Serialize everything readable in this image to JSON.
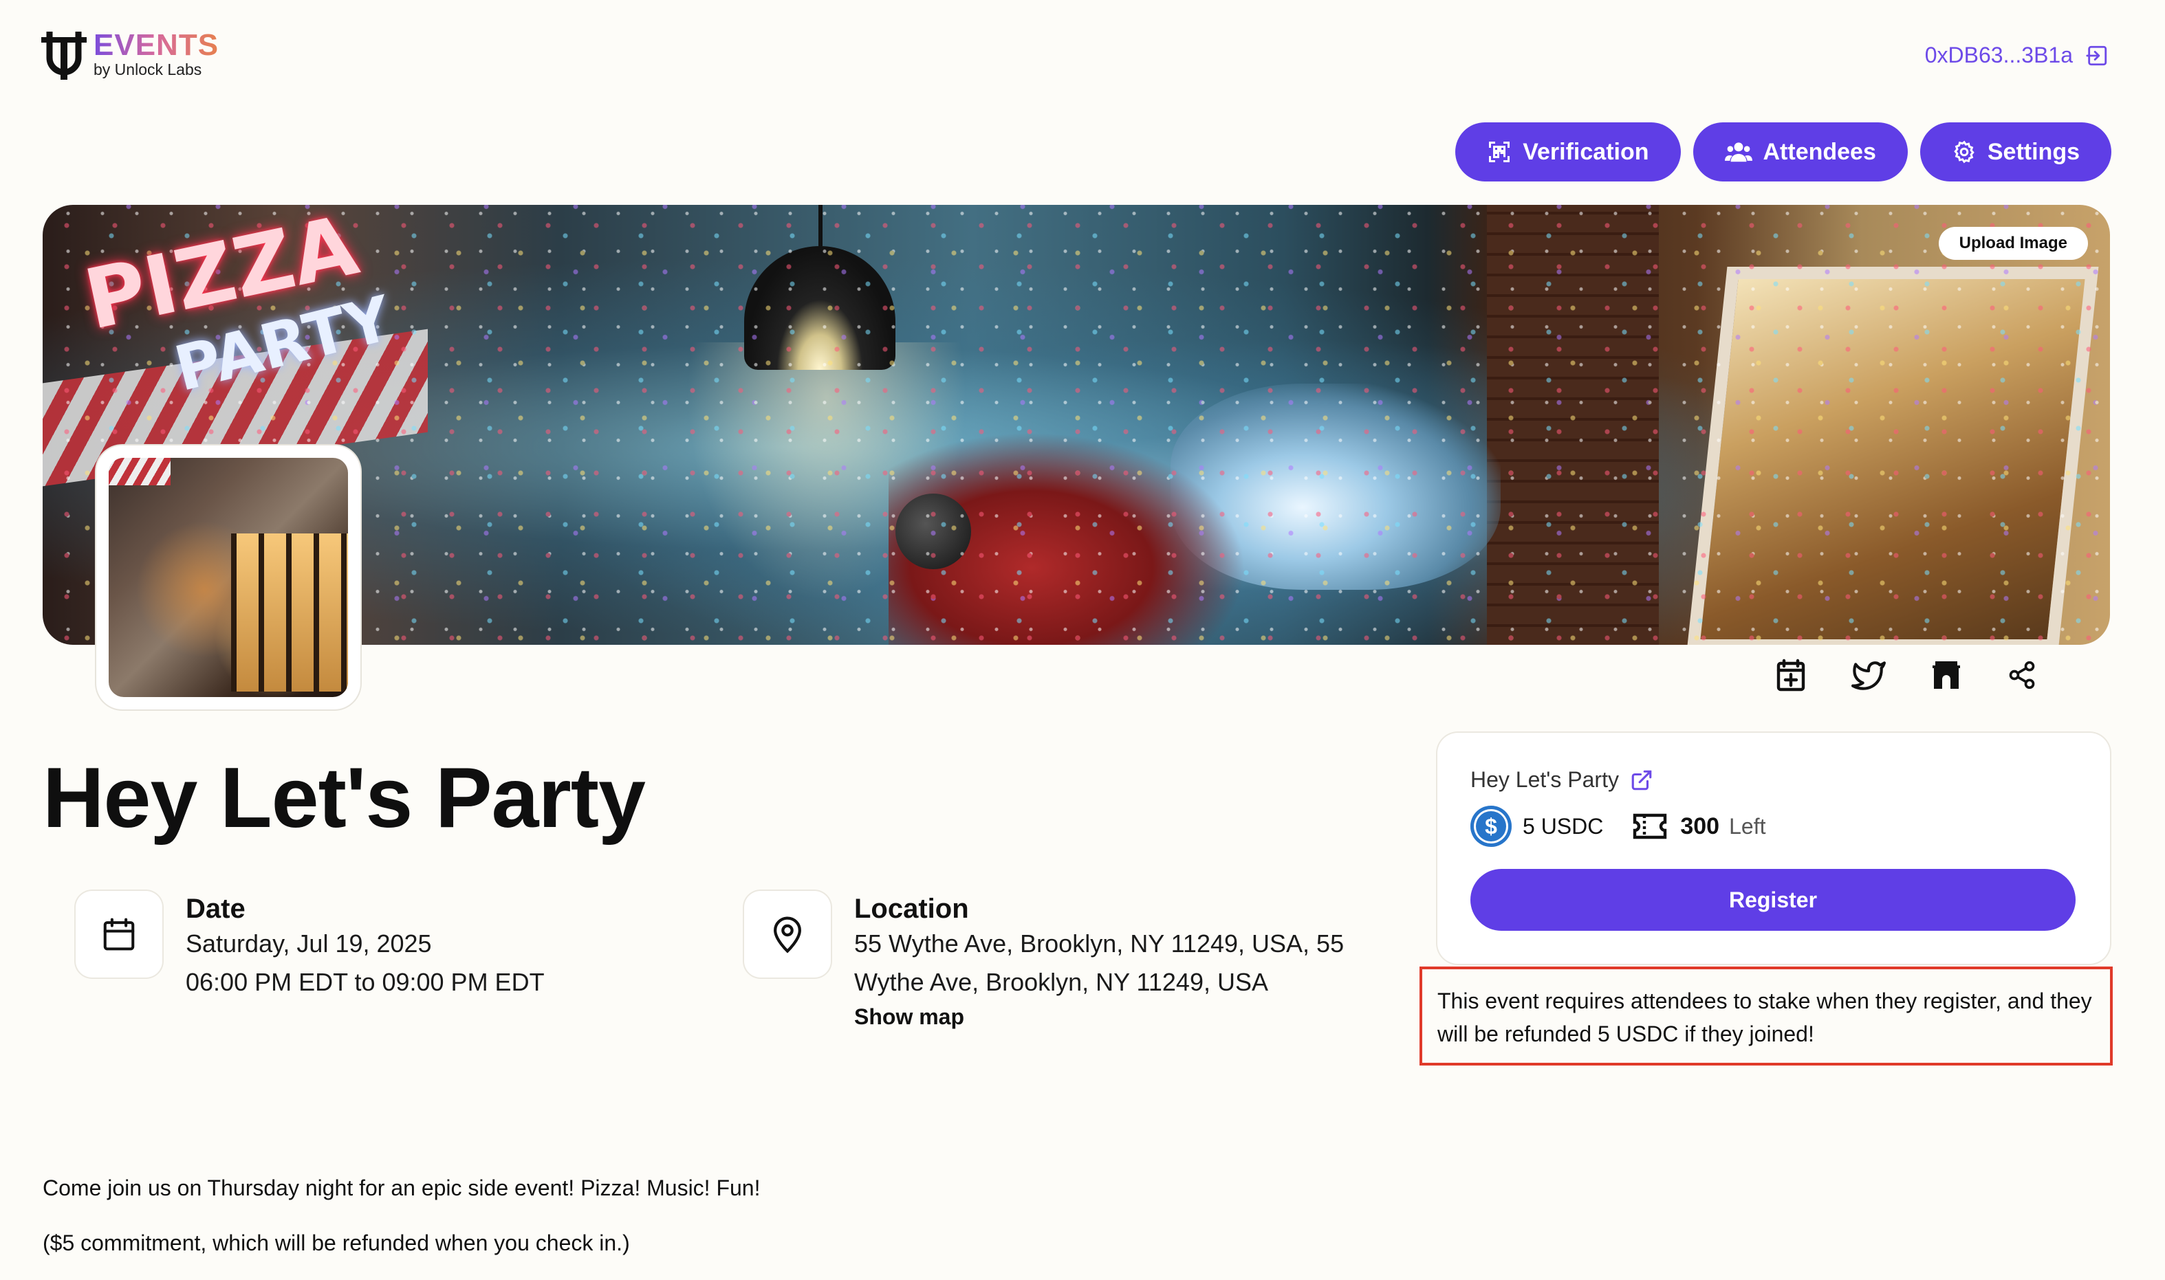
{
  "header": {
    "logo_title": "EVENTS",
    "logo_subtitle": "by Unlock Labs",
    "wallet": "0xDB63...3B1a"
  },
  "toolbar": {
    "verification": "Verification",
    "attendees": "Attendees",
    "settings": "Settings"
  },
  "banner": {
    "upload_label": "Upload Image",
    "sign_line1": "PIZZA",
    "sign_line2": "PARTY"
  },
  "event": {
    "title": "Hey Let's Party",
    "date_label": "Date",
    "date_value": "Saturday, Jul 19, 2025",
    "time_value": "06:00 PM EDT to 09:00 PM EDT",
    "location_label": "Location",
    "location_line1": "55 Wythe Ave, Brooklyn, NY 11249, USA, 55",
    "location_line2": "Wythe Ave, Brooklyn, NY 11249, USA",
    "show_map": "Show map"
  },
  "ticket": {
    "name": "Hey Let's Party",
    "price": "5 USDC",
    "remaining": "300",
    "remaining_label": "Left",
    "register_label": "Register",
    "coin_symbol": "$"
  },
  "notice": "This event requires attendees to stake when they register, and they will be refunded 5 USDC if they joined!",
  "description": {
    "line1": "Come join us on Thursday night for an epic side event! Pizza! Music! Fun!",
    "line2": "($5 commitment, which will be refunded when you check in.)"
  },
  "colors": {
    "accent": "#5f3ee6",
    "wallet_text": "#6d4ae8",
    "usdc": "#2775ca",
    "notice_border": "#e03a2a",
    "background": "#fdfcf8"
  },
  "icons": [
    "logo-mark-icon",
    "logout-icon",
    "qr-scan-icon",
    "users-icon",
    "gear-icon",
    "external-link-icon",
    "usdc-coin-icon",
    "ticket-icon",
    "calendar-add-icon",
    "twitter-icon",
    "farcaster-icon",
    "share-icon",
    "calendar-icon",
    "map-pin-icon"
  ]
}
